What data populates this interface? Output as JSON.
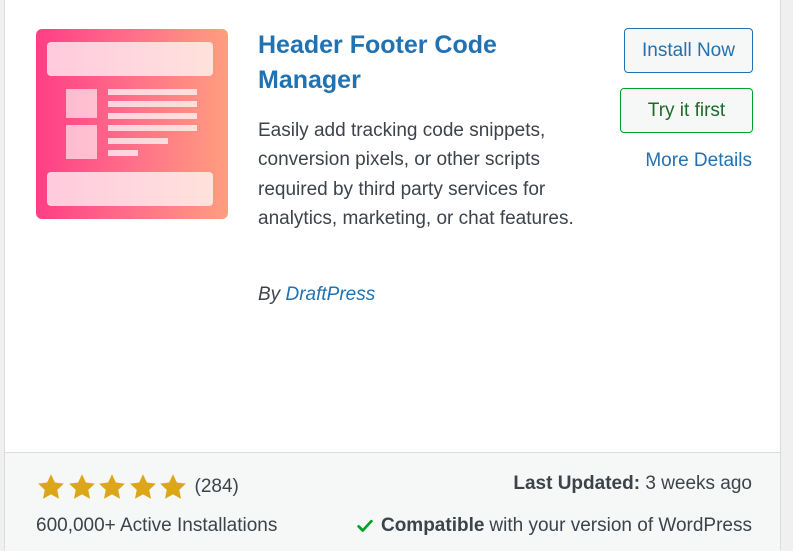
{
  "plugin": {
    "name": "Header Footer Code Manager",
    "description": "Easily add tracking code snippets, conversion pixels, or other scripts required by third party services for analytics, marketing, or chat features.",
    "author_prefix": "By",
    "author": "DraftPress",
    "icon": "header-footer-layout-icon"
  },
  "actions": {
    "install_label": "Install Now",
    "try_label": "Try it first",
    "more_details_label": "More Details"
  },
  "meta": {
    "rating_stars": 5,
    "rating_max": 5,
    "rating_count": "(284)",
    "active_installs": "600,000+ Active Installations",
    "last_updated_label": "Last Updated:",
    "last_updated_value": "3 weeks ago",
    "compat_label": "Compatible",
    "compat_text": "with your version of WordPress"
  },
  "colors": {
    "link": "#2271b1",
    "star": "#dba617",
    "check": "#00a32a",
    "icon_gradient_start": "#ff3e86",
    "icon_gradient_end": "#ff9e7f"
  }
}
